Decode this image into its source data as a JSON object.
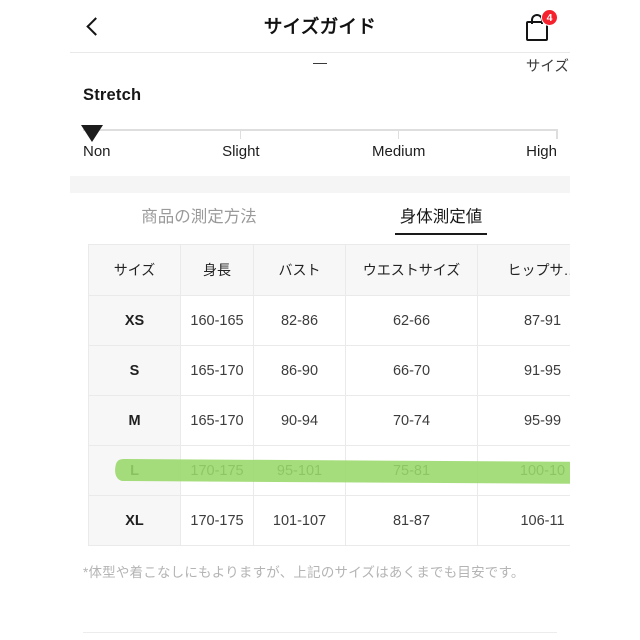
{
  "navbar": {
    "back_icon": "chevron-left-icon",
    "title": "サイズガイド",
    "cart_icon": "shopping-bag-icon",
    "cart_badge": "4"
  },
  "clipped_row": {
    "center_value": "—",
    "right_label": "サイズ"
  },
  "stretch": {
    "title": "Stretch",
    "marker_icon": "triangle-down-marker",
    "marker_position_pct": 0,
    "labels": [
      {
        "text": "Non",
        "pct": 0
      },
      {
        "text": "Slight",
        "pct": 33.3
      },
      {
        "text": "Medium",
        "pct": 66.6
      },
      {
        "text": "High",
        "pct": 100
      }
    ],
    "ticks_pct": [
      33.3,
      66.6,
      100
    ]
  },
  "tabs": [
    {
      "label": "商品の測定方法",
      "active": false
    },
    {
      "label": "身体測定値",
      "active": true
    }
  ],
  "table": {
    "columns": [
      "サイズ",
      "身長",
      "バスト",
      "ウエストサイズ",
      "ヒップサ…",
      ""
    ],
    "rows": [
      {
        "size": "XS",
        "height": "160-165",
        "bust": "82-86",
        "waist": "62-66",
        "hip": "87-91",
        "extra": "",
        "highlighted": false
      },
      {
        "size": "S",
        "height": "165-170",
        "bust": "86-90",
        "waist": "66-70",
        "hip": "91-95",
        "extra": "",
        "highlighted": false
      },
      {
        "size": "M",
        "height": "165-170",
        "bust": "90-94",
        "waist": "70-74",
        "hip": "95-99",
        "extra": "",
        "highlighted": true
      },
      {
        "size": "L",
        "height": "170-175",
        "bust": "95-101",
        "waist": "75-81",
        "hip": "100-10",
        "extra": "",
        "highlighted": false
      },
      {
        "size": "XL",
        "height": "170-175",
        "bust": "101-107",
        "waist": "81-87",
        "hip": "106-11",
        "extra": "",
        "highlighted": false
      }
    ]
  },
  "footnote": "*体型や着こなしにもよりますが、上記のサイズはあくまでも目安です。",
  "colors": {
    "highlighter_green": "#9ad86a",
    "badge_red": "#f5222d",
    "text_primary": "#1a1a1a",
    "text_muted": "#9a9a9a",
    "band_grey": "#f5f5f5"
  }
}
